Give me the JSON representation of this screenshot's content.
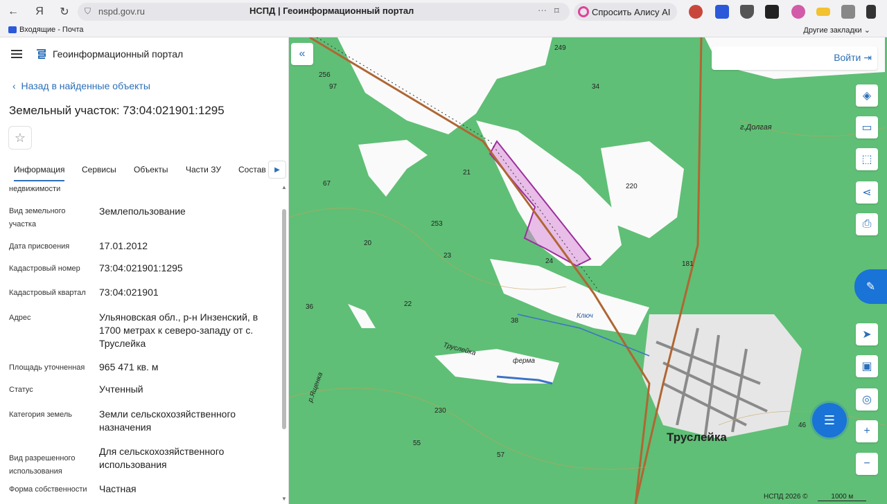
{
  "browser": {
    "url_domain": "nspd.gov.ru",
    "tab_title": "НСПД | Геоинформационный портал",
    "alice_label": "Спросить Алису AI",
    "bookmark_mail": "Входящие - Почта",
    "other_bookmarks": "Другие закладки"
  },
  "app": {
    "title": "Геоинформационный портал",
    "back_label": "Назад в найденные объекты",
    "page_title": "Земельный участок: 73:04:021901:1295"
  },
  "tabs": [
    {
      "label": "Информация"
    },
    {
      "label": "Сервисы"
    },
    {
      "label": "Объекты"
    },
    {
      "label": "Части ЗУ"
    },
    {
      "label": "Состав"
    }
  ],
  "props": {
    "truncated_label": "недвижимости",
    "rows": [
      {
        "label": "Вид земельного участка",
        "value": "Землепользование"
      },
      {
        "label": "Дата присвоения",
        "value": "17.01.2012"
      },
      {
        "label": "Кадастровый номер",
        "value": "73:04:021901:1295"
      },
      {
        "label": "Кадастровый квартал",
        "value": "73:04:021901"
      },
      {
        "label": "Адрес",
        "value": "Ульяновская обл., р-н Инзенский, в 1700 метрах к северо-западу от с. Труслейка"
      },
      {
        "label": "Площадь уточненная",
        "value": "965 471 кв. м"
      },
      {
        "label": "Статус",
        "value": "Учтенный"
      },
      {
        "label": "Категория земель",
        "value": "Земли сельскохозяйственного назначения"
      },
      {
        "label": "Вид разрешенного использования",
        "value": "Для сельскохозяйственного использования"
      },
      {
        "label": "Форма собственности",
        "value": "Частная"
      }
    ]
  },
  "map": {
    "login_label": "Войти",
    "town_label": "Труслейка",
    "scale_label": "1000 м",
    "copyright": "НСПД 2026 ©",
    "place_labels": [
      "г.Долгая",
      "ферма",
      "Ключ",
      "Труслейка",
      "р.Ященка"
    ],
    "numbers": [
      "249",
      "256",
      "97",
      "34",
      "21",
      "220",
      "67",
      "253",
      "20",
      "23",
      "24",
      "181",
      "22",
      "36",
      "38",
      "230",
      "55",
      "57",
      "46"
    ]
  }
}
